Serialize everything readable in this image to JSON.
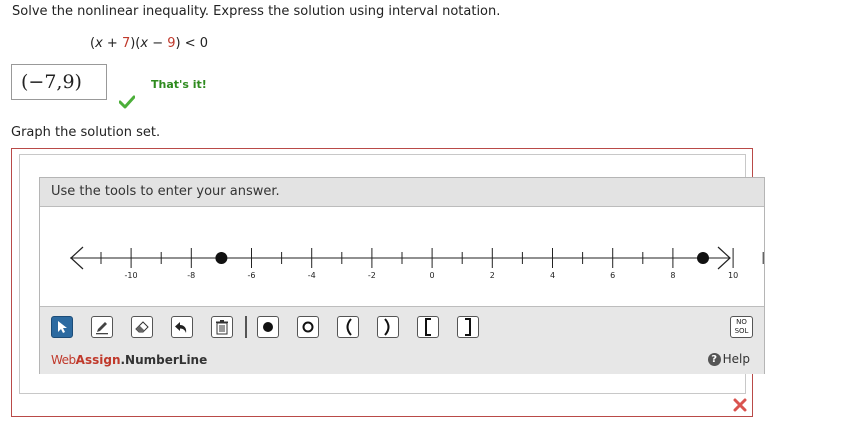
{
  "question": "Solve the nonlinear inequality. Express the solution using interval notation.",
  "inequality": {
    "open1": "(",
    "var1": "x",
    "plus": " + ",
    "n1": "7",
    "mid": ")(",
    "var2": "x",
    "minus": " − ",
    "n2": "9",
    "close": ") < 0"
  },
  "answer": "(−7,9)",
  "feedback": "That's it!",
  "graph_prompt": "Graph the solution set.",
  "widget": {
    "header": "Use the tools to enter your answer.",
    "number_line": {
      "min": -11,
      "max": 11,
      "tick_labels": [
        "-10",
        "-8",
        "-6",
        "-4",
        "-2",
        "0",
        "2",
        "4",
        "6",
        "8",
        "10"
      ],
      "closed_points": [
        -7,
        9
      ]
    },
    "tools": [
      "select-tool",
      "pencil-tool",
      "eraser-tool",
      "undo-tool",
      "delete-tool",
      "closed-point-tool",
      "open-point-tool",
      "left-paren-tool",
      "right-paren-tool",
      "left-bracket-tool",
      "right-bracket-tool"
    ],
    "nosol_label": "NO\nSOL",
    "brand_web": "Web",
    "brand_assign": "Assign",
    "brand_rest": ".NumberLine",
    "help_label": "Help",
    "help_icon": "?"
  },
  "colors": {
    "correct": "#2e8b1e",
    "incorrect": "#d9534f",
    "frame": "#b94a48",
    "select_active": "#2c6aa0"
  }
}
